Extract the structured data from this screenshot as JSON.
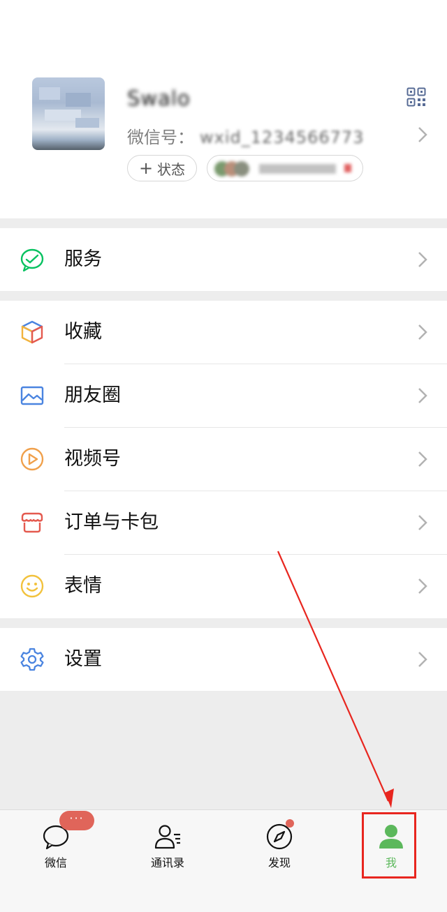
{
  "profile": {
    "nickname": "Swalo",
    "wechat_id_label": "微信号：",
    "wechat_id_value": "wxid_1234566773",
    "status_button": "状态",
    "status_plus": "+"
  },
  "menu": {
    "services": "服务",
    "favorites": "收藏",
    "moments": "朋友圈",
    "channels": "视频号",
    "orders_cards": "订单与卡包",
    "stickers": "表情",
    "settings": "设置"
  },
  "tabbar": {
    "chats": "微信",
    "contacts": "通讯录",
    "discover": "发现",
    "me": "我",
    "chats_badge": "···"
  },
  "colors": {
    "accent": "#07c160",
    "me_active": "#5cb85c",
    "badge": "#e0655a",
    "annotation_red": "#e8261f"
  }
}
